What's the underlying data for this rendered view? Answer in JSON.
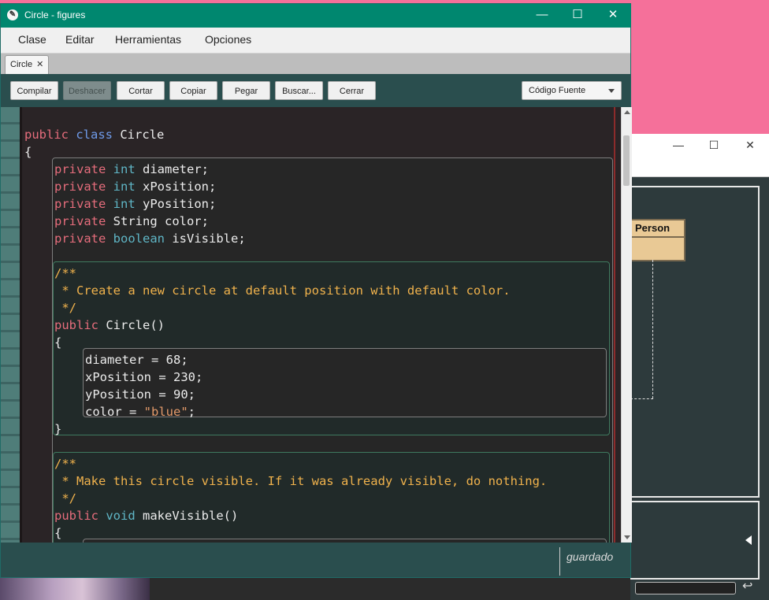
{
  "main_window": {
    "title": "Circle - figures",
    "controls": {
      "minimize": "—",
      "maximize": "☐",
      "close": "✕"
    },
    "menu": [
      "Clase",
      "Editar",
      "Herramientas",
      "Opciones"
    ],
    "tab": {
      "label": "Circle",
      "close": "✕"
    },
    "toolbar": {
      "buttons": [
        {
          "label": "Compilar",
          "enabled": true
        },
        {
          "label": "Deshacer",
          "enabled": false
        },
        {
          "label": "Cortar",
          "enabled": true
        },
        {
          "label": "Copiar",
          "enabled": true
        },
        {
          "label": "Pegar",
          "enabled": true
        },
        {
          "label": "Buscar...",
          "enabled": true
        },
        {
          "label": "Cerrar",
          "enabled": true
        }
      ],
      "view_select": "Código Fuente"
    },
    "code": {
      "class_decl": {
        "k1": "public",
        "k2": "class",
        "name": " Circle"
      },
      "brace_open": "{",
      "fields": [
        {
          "mod": "private",
          "type": "int",
          "name": " diameter;"
        },
        {
          "mod": "private",
          "type": "int",
          "name": " xPosition;"
        },
        {
          "mod": "private",
          "type": "int",
          "name": " yPosition;"
        },
        {
          "mod": "private",
          "type": "",
          "name": " String color;"
        },
        {
          "mod": "private",
          "type": "boolean",
          "name": " isVisible;"
        }
      ],
      "comment1": [
        "/**",
        " * Create a new circle at default position with default color.",
        " */"
      ],
      "ctor": {
        "mod": "public",
        "name": " Circle()"
      },
      "ctor_brace_open": "{",
      "ctor_body": [
        "diameter = 68;",
        "xPosition = 230;",
        "yPosition = 90;"
      ],
      "ctor_color": {
        "lhs": "color = ",
        "str": "\"blue\"",
        "end": ";"
      },
      "ctor_brace_close": "}",
      "comment2": [
        "/**",
        " * Make this circle visible. If it was already visible, do nothing.",
        " */"
      ],
      "method2": {
        "mod": "public",
        "type": "void",
        "name": " makeVisible()"
      },
      "method2_brace_open": "{"
    },
    "status": "guardado"
  },
  "background_window": {
    "class_box": "Person",
    "controls": {
      "minimize": "—",
      "maximize": "☐",
      "close": "✕"
    },
    "enter_icon": "↩"
  }
}
